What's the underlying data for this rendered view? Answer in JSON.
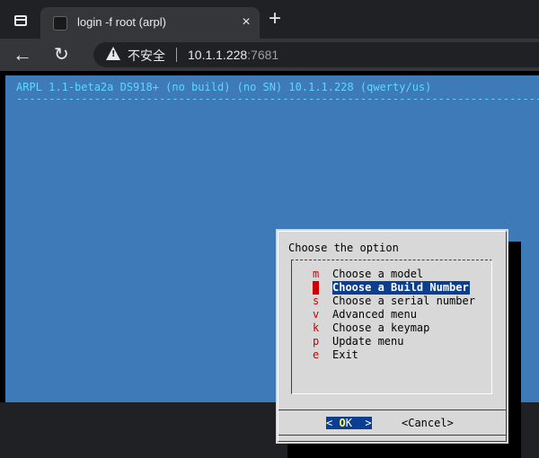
{
  "browser": {
    "tab_title": "login -f root (arpl)",
    "tab_close": "×",
    "new_tab": "+",
    "security_label": "不安全",
    "url_host": "10.1.1.228",
    "url_port": ":7681"
  },
  "terminal": {
    "backtitle": "ARPL 1.1-beta2a DS918+ (no build) (no SN) 10.1.1.228 (qwerty/us)",
    "backline": "------------------------------------------------------------------------------------------------",
    "dialog": {
      "prompt": "Choose the option",
      "items": [
        {
          "tag": "m",
          "label": "Choose a model"
        },
        {
          "tag": "n",
          "label": "Choose a Build Number"
        },
        {
          "tag": "s",
          "label": "Choose a serial number"
        },
        {
          "tag": "v",
          "label": "Advanced menu"
        },
        {
          "tag": "k",
          "label": "Choose a keymap"
        },
        {
          "tag": "p",
          "label": "Update menu"
        },
        {
          "tag": "e",
          "label": "Exit"
        }
      ],
      "selected_index": 1,
      "ok_left": "< ",
      "ok_hot": "O",
      "ok_rest": "K  >",
      "cancel": "<Cancel>"
    }
  },
  "colors": {
    "screen_bg": "#3e7ab8",
    "backtitle": "#5fd7ff",
    "dialog_bg": "#d8d8d8",
    "highlight": "#0b3d91",
    "tag": "#cc0000"
  },
  "icons": [
    "window-icon",
    "tab-favicon",
    "close-icon",
    "plus-icon",
    "back-arrow-icon",
    "reload-icon",
    "warning-icon"
  ]
}
